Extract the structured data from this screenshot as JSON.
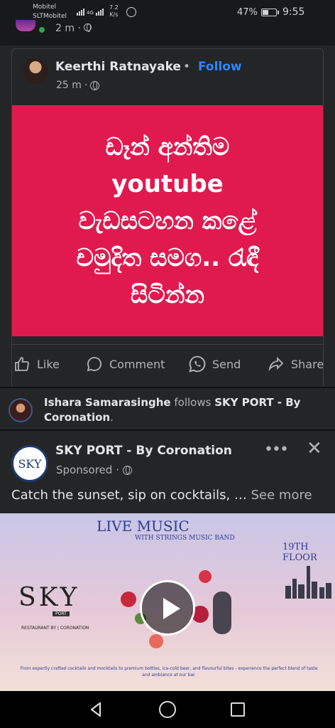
{
  "status_bar": {
    "carrier1": "Mobitel",
    "carrier2": "SLTMobitel",
    "net_label": "4G",
    "speed_value": "7.2",
    "speed_unit": "K/s",
    "battery": "47%",
    "time": "9:55"
  },
  "previous_post": {
    "time": "2 m"
  },
  "shared_post": {
    "author": "Keerthi Ratnayake",
    "separator": "•",
    "follow": "Follow",
    "time": "25 m",
    "visibility_icon": "globe-icon",
    "image_text_lines": [
      "ඩෑන් අන්තිම",
      "youtube",
      "වැඩසටහන කළේ",
      "චමුදිත සමග.. රැඳී",
      "සිටින්න"
    ],
    "image_bg": "#e01a4f",
    "actions": {
      "like": "Like",
      "comment": "Comment",
      "send": "Send",
      "share": "Share"
    }
  },
  "activity": {
    "user": "Ishara Samarasinghe",
    "verb": " follows ",
    "page": "SKY PORT - By Coronation",
    "end": "."
  },
  "ad_post": {
    "page_name": "SKY PORT - By Coronation",
    "logo_text": "SKY",
    "sponsored": "Sponsored",
    "more": "•••",
    "close": "✕",
    "text": "Catch the sunset, sip on cocktails, … ",
    "see_more": "See more",
    "image": {
      "headline": "LIVE MUSIC",
      "band": "WITH STRINGS MUSIC BAND",
      "floor": [
        "19TH",
        "FLOOR"
      ],
      "logo": "SKY",
      "logo_port": "PORT",
      "restaurant": "RESTAURANT BY | CORONATION",
      "footer": "From expertly crafted cocktails and mocktails to premium bottles, ice-cold beer, and flavourful bites - experience the perfect blend of taste and ambiance at our bar."
    }
  },
  "colors": {
    "bg": "#18191a",
    "card": "#242526",
    "accent": "#2d88ff",
    "text": "#e4e6eb",
    "muted": "#b0b3b8"
  }
}
